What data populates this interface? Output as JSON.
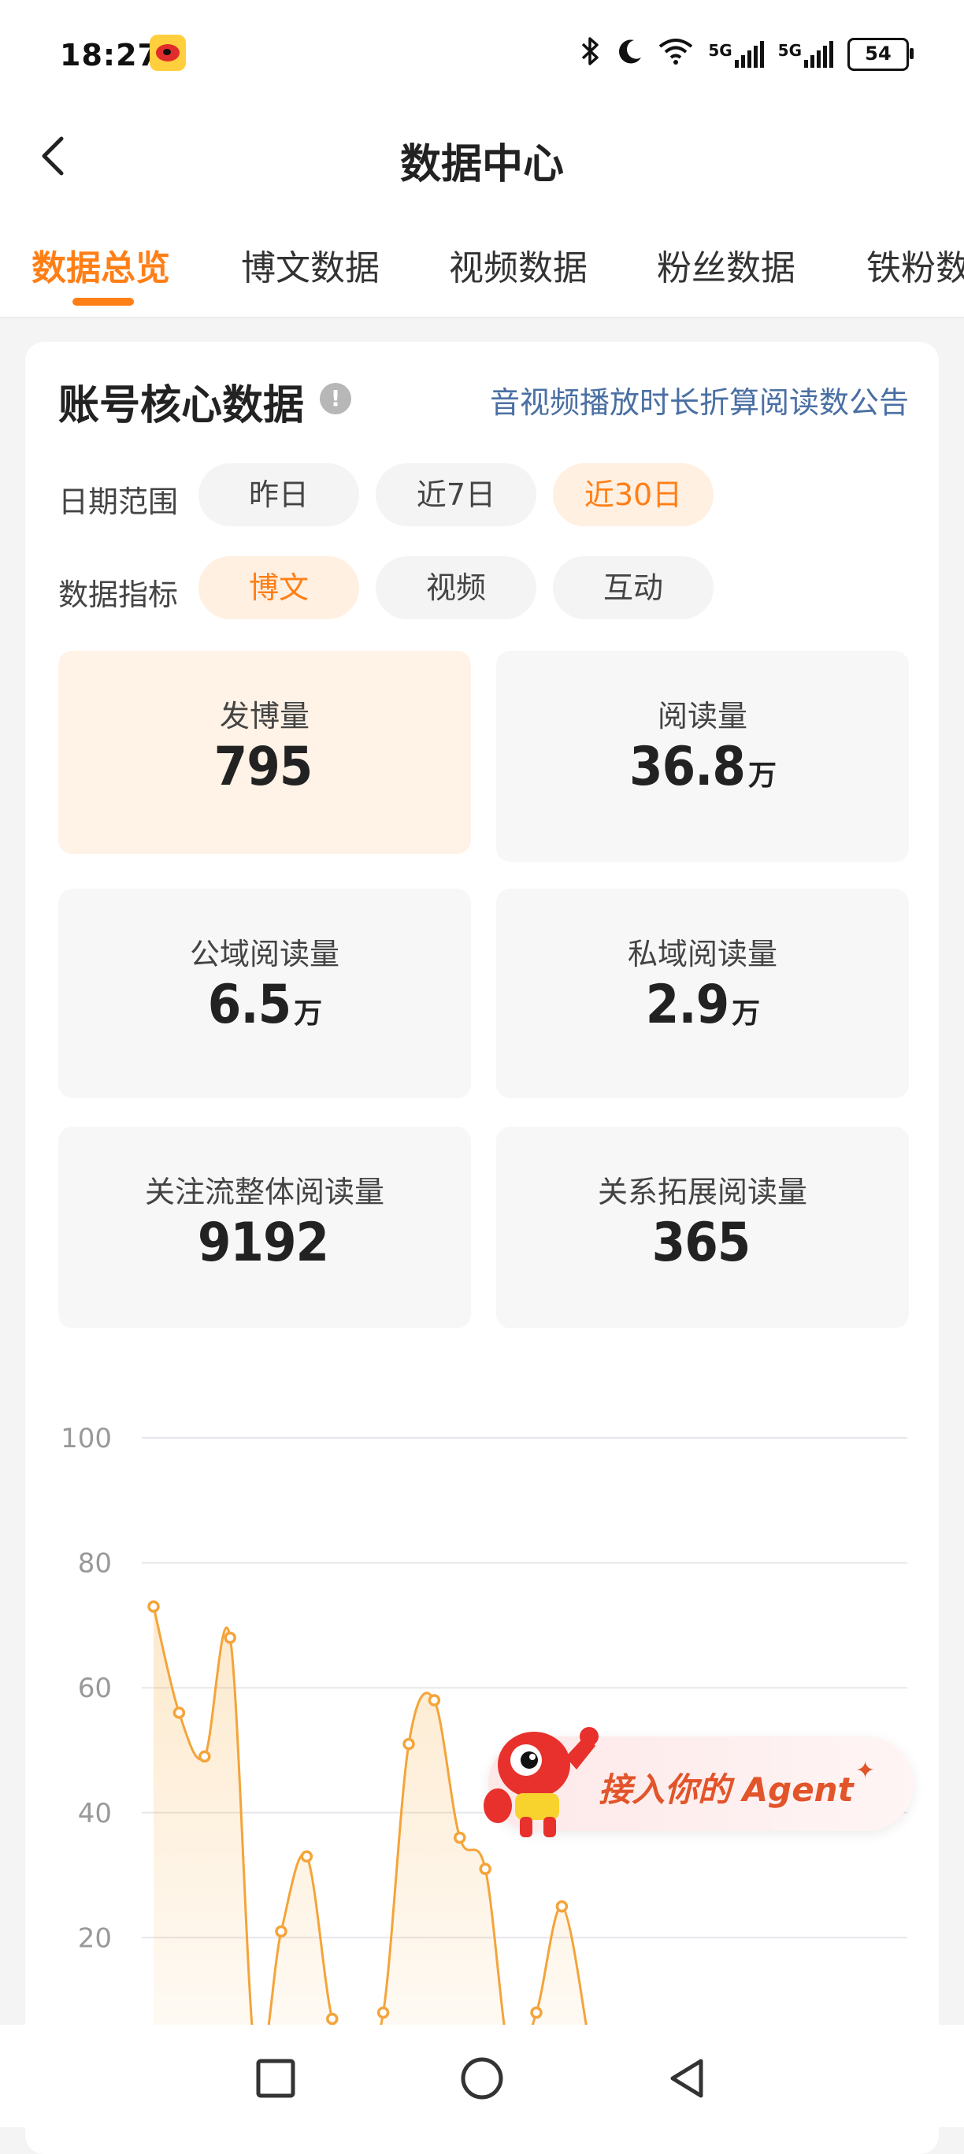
{
  "status_bar": {
    "time": "18:27",
    "battery": "54",
    "signal_label_1": "5G",
    "signal_label_2": "5G"
  },
  "header": {
    "title": "数据中心",
    "back_icon": "chevron-left-icon"
  },
  "tabs": [
    {
      "label": "数据总览",
      "active": true
    },
    {
      "label": "博文数据",
      "active": false
    },
    {
      "label": "视频数据",
      "active": false
    },
    {
      "label": "粉丝数据",
      "active": false
    },
    {
      "label": "铁粉数",
      "active": false
    }
  ],
  "card": {
    "title": "账号核心数据",
    "info_icon": "info-icon",
    "notice_link": "音视频播放时长折算阅读数公告",
    "date_range": {
      "label": "日期范围",
      "options": [
        "昨日",
        "近7日",
        "近30日"
      ],
      "selected": "近30日"
    },
    "metric_type": {
      "label": "数据指标",
      "options": [
        "博文",
        "视频",
        "互动"
      ],
      "selected": "博文"
    },
    "metrics": [
      {
        "label": "发博量",
        "value": "795",
        "unit": ""
      },
      {
        "label": "阅读量",
        "value": "36.8",
        "unit": "万"
      },
      {
        "label": "公域阅读量",
        "value": "6.5",
        "unit": "万"
      },
      {
        "label": "私域阅读量",
        "value": "2.9",
        "unit": "万"
      },
      {
        "label": "关注流整体阅读量",
        "value": "9192",
        "unit": ""
      },
      {
        "label": "关系拓展阅读量",
        "value": "365",
        "unit": ""
      }
    ]
  },
  "chart_data": {
    "type": "area",
    "ylim": [
      0,
      100
    ],
    "yticks": [
      "100",
      "80",
      "60",
      "40",
      "20"
    ],
    "grid": true,
    "series": [
      {
        "color": "#f4a43a",
        "x": [
          1,
          2,
          3,
          4,
          5,
          6,
          7,
          8,
          9,
          10,
          11,
          12,
          13,
          14,
          15,
          16,
          17,
          18
        ],
        "values": [
          73,
          56,
          49,
          68,
          0,
          21,
          33,
          7,
          0,
          8,
          51,
          58,
          36,
          31,
          0,
          8,
          25,
          5
        ]
      }
    ]
  },
  "agent_banner": {
    "text": "接入你的 Agent",
    "sparkle": "✦"
  },
  "nav_bar": {
    "icons": [
      "square-recents-icon",
      "circle-home-icon",
      "triangle-back-icon"
    ]
  }
}
